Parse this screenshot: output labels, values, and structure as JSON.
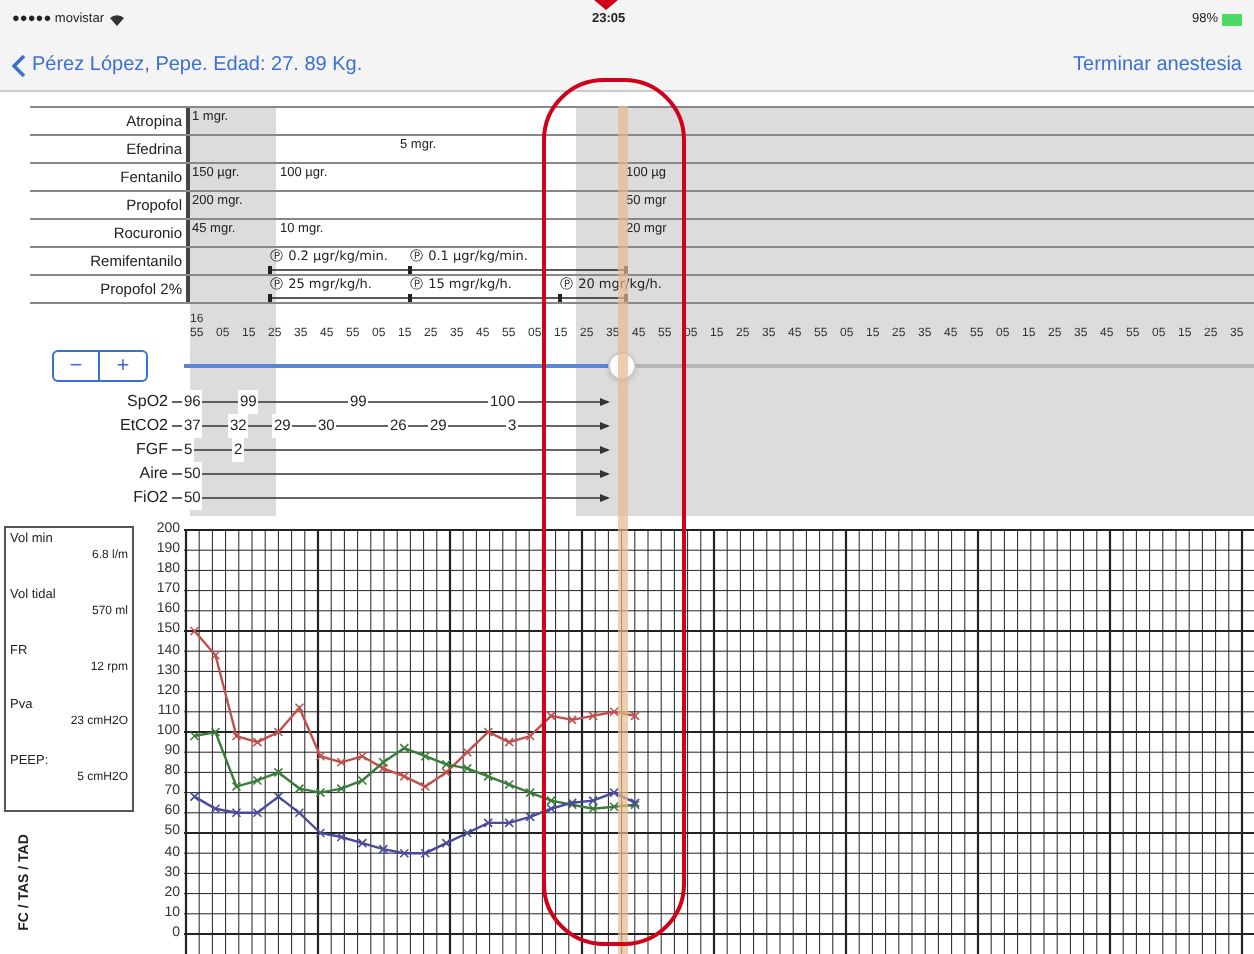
{
  "status_bar": {
    "carrier": "●●●●● movistar",
    "time": "23:05",
    "battery": "98%"
  },
  "nav": {
    "title": "Pérez López, Pepe. Edad: 27. 89 Kg.",
    "action": "Terminar anestesia"
  },
  "drugs": [
    {
      "name": "Atropina",
      "kind": "bolus",
      "doses": [
        "1 mgr."
      ]
    },
    {
      "name": "Efedrina",
      "kind": "bolus",
      "doses": [
        "5 mgr."
      ]
    },
    {
      "name": "Fentanilo",
      "kind": "bolus",
      "doses": [
        "150 µgr.",
        "100 µgr.",
        "100 µg"
      ]
    },
    {
      "name": "Propofol",
      "kind": "bolus",
      "doses": [
        "200 mgr.",
        "50 mgr"
      ]
    },
    {
      "name": "Rocuronio",
      "kind": "bolus",
      "doses": [
        "45 mgr.",
        "10 mgr.",
        "20 mgr"
      ]
    },
    {
      "name": "Remifentanilo",
      "kind": "infusion",
      "doses": [
        "Ⓟ 0.2 µgr/kg/min.",
        "Ⓟ 0.1 µgr/kg/min."
      ]
    },
    {
      "name": "Propofol 2%",
      "kind": "infusion",
      "doses": [
        "Ⓟ 25 mgr/kg/h.",
        "Ⓟ 15 mgr/kg/h.",
        "Ⓟ 20 mgr/kg/h."
      ]
    }
  ],
  "timeline": {
    "hour": "16",
    "ticks": [
      "55",
      "05",
      "15",
      "25",
      "35",
      "45",
      "55",
      "05",
      "15",
      "25",
      "35",
      "45",
      "55",
      "05",
      "15",
      "25",
      "35",
      "45",
      "55",
      "05",
      "15",
      "25",
      "35",
      "45",
      "55",
      "05",
      "15",
      "25",
      "35",
      "45",
      "55",
      "05",
      "15",
      "25",
      "35",
      "45",
      "55",
      "05",
      "15",
      "25",
      "35"
    ]
  },
  "zoom": {
    "minus": "−",
    "plus": "+",
    "level": 0.41
  },
  "vitals": [
    {
      "name": "SpO2",
      "values": [
        "96",
        "99",
        "99",
        "100"
      ]
    },
    {
      "name": "EtCO2",
      "values": [
        "37",
        "32",
        "29",
        "30",
        "26",
        "29",
        "3"
      ]
    },
    {
      "name": "FGF",
      "values": [
        "5",
        "2"
      ]
    },
    {
      "name": "Aire",
      "values": [
        "50"
      ]
    },
    {
      "name": "FiO2",
      "values": [
        "50"
      ]
    }
  ],
  "ventilation": [
    {
      "label": "Vol min",
      "value": "6.8 l/m"
    },
    {
      "label": "Vol tidal",
      "value": "570 ml"
    },
    {
      "label": "FR",
      "value": "12 rpm"
    },
    {
      "label": "Pva",
      "value": "23 cmH2O"
    },
    {
      "label": "PEEP:",
      "value": "5 cmH2O"
    }
  ],
  "chart": {
    "chart_data": {
      "type": "line",
      "ylabel": "FC / TAS / TAD",
      "grid": true,
      "categories": [
        null,
        null,
        null,
        null,
        null,
        null,
        null,
        null,
        null,
        null,
        null,
        null,
        null,
        null,
        null,
        null,
        null,
        null,
        null,
        null,
        null,
        null,
        null,
        null,
        null,
        null,
        null,
        null,
        null,
        null,
        null,
        null,
        null,
        null,
        null,
        null,
        null,
        null,
        null,
        null,
        null,
        null,
        null,
        null,
        null,
        null,
        null,
        null,
        null,
        null,
        null
      ],
      "ylim": [
        0,
        200
      ],
      "yticks": [
        0,
        10,
        20,
        30,
        40,
        50,
        60,
        70,
        80,
        90,
        100,
        110,
        120,
        130,
        140,
        150,
        160,
        170,
        180,
        190,
        200
      ],
      "series": [
        {
          "color": "#c0504d",
          "marker": "cross",
          "values": [
            150,
            138,
            98,
            95,
            100,
            112,
            88,
            85,
            88,
            82,
            78,
            73,
            80,
            90,
            100,
            95,
            98,
            108,
            106,
            108,
            110,
            108,
            null,
            null,
            null,
            null,
            null,
            null,
            null,
            null,
            null,
            null,
            null,
            null,
            null,
            null,
            null,
            null,
            null,
            null,
            null,
            null,
            null,
            null,
            null,
            null,
            null,
            null,
            null,
            null,
            null
          ]
        },
        {
          "color": "#3a7d3a",
          "marker": "cross",
          "values": [
            98,
            100,
            73,
            76,
            80,
            72,
            70,
            72,
            76,
            85,
            92,
            88,
            84,
            82,
            78,
            74,
            70,
            66,
            64,
            62,
            63,
            64,
            null,
            null,
            null,
            null,
            null,
            null,
            null,
            null,
            null,
            null,
            null,
            null,
            null,
            null,
            null,
            null,
            null,
            null,
            null,
            null,
            null,
            null,
            null,
            null,
            null,
            null,
            null,
            null,
            null
          ]
        },
        {
          "color": "#4a4a9a",
          "marker": "cross",
          "values": [
            68,
            62,
            60,
            60,
            68,
            60,
            50,
            48,
            45,
            42,
            40,
            40,
            45,
            50,
            55,
            55,
            58,
            62,
            65,
            66,
            70,
            65,
            null,
            null,
            null,
            null,
            null,
            null,
            null,
            null,
            null,
            null,
            null,
            null,
            null,
            null,
            null,
            null,
            null,
            null,
            null,
            null,
            null,
            null,
            null,
            null,
            null,
            null,
            null,
            null,
            null
          ]
        }
      ]
    }
  }
}
